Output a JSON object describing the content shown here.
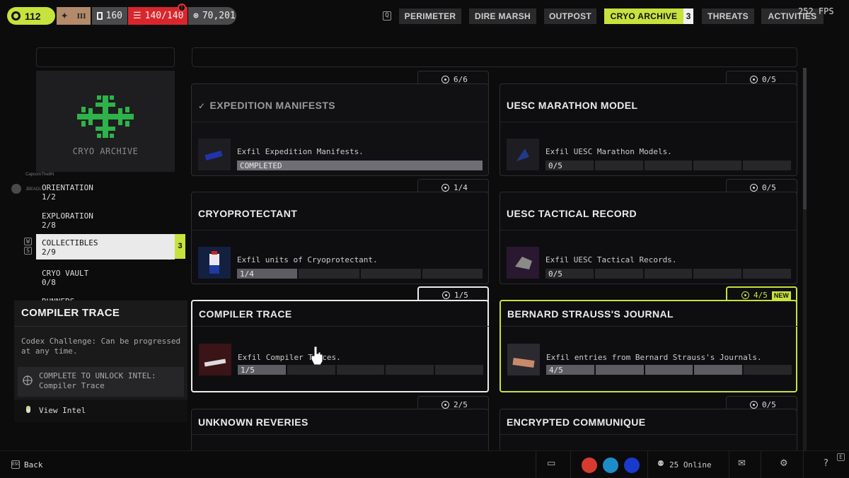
{
  "hud": {
    "level": "112",
    "rank_numeral": "III",
    "vault_count": "160",
    "health": "140/140",
    "credits": "70,201",
    "alert_icon": "!",
    "fps": "252 FPS"
  },
  "nav": {
    "q_key": "Q",
    "tabs": [
      {
        "label": "PERIMETER"
      },
      {
        "label": "DIRE MARSH"
      },
      {
        "label": "OUTPOST"
      },
      {
        "label": "CRYO ARCHIVE"
      },
      {
        "label": "THREATS"
      },
      {
        "label": "ACTIVITIES"
      }
    ],
    "active_count": "3",
    "e_key": "E"
  },
  "left": {
    "emblem_label": "CRYO ARCHIVE",
    "emblem_color": "#2fb24a",
    "categories": [
      {
        "name": "ORIENTATION",
        "progress": "1/2"
      },
      {
        "name": "EXPLORATION",
        "progress": "2/8"
      },
      {
        "name": "COLLECTIBLES",
        "progress": "2/9"
      },
      {
        "name": "CRYO VAULT",
        "progress": "0/8"
      },
      {
        "name": "RUNNERS",
        "progress": ""
      }
    ],
    "active_badge": "3",
    "key_w": "W",
    "key_s": "S",
    "chat": [
      "CapcomThe8N",
      "JBEADL"
    ]
  },
  "info": {
    "title": "COMPILER TRACE",
    "desc": "Codex Challenge: Can be progressed at any time.",
    "unlock_line1": "COMPLETE TO UNLOCK INTEL:",
    "unlock_line2": "Compiler Trace",
    "view_intel": "View Intel"
  },
  "cards": [
    {
      "title": "EXPEDITION MANIFESTS",
      "count": "6/6",
      "desc": "Exfil Expedition Manifests.",
      "progress": "COMPLETED",
      "segments": 1,
      "filled": 1,
      "state": "completed",
      "thumb_icon": "blue-case-icon"
    },
    {
      "title": "UESC MARATHON MODEL",
      "count": "0/5",
      "desc": "Exfil UESC Marathon Models.",
      "progress": "0/5",
      "segments": 5,
      "filled": 0,
      "state": "normal",
      "thumb_icon": "model-icon"
    },
    {
      "title": "CRYOPROTECTANT",
      "count": "1/4",
      "desc": "Exfil units of Cryoprotectant.",
      "progress": "1/4",
      "segments": 4,
      "filled": 1,
      "state": "normal",
      "thumb_icon": "canister-icon"
    },
    {
      "title": "UESC TACTICAL RECORD",
      "count": "0/5",
      "desc": "Exfil UESC Tactical Records.",
      "progress": "0/5",
      "segments": 5,
      "filled": 0,
      "state": "normal",
      "thumb_icon": "record-icon"
    },
    {
      "title": "COMPILER TRACE",
      "count": "1/5",
      "desc": "Exfil Compiler Traces.",
      "progress": "1/5",
      "segments": 5,
      "filled": 1,
      "state": "selected",
      "thumb_icon": "trace-icon"
    },
    {
      "title": "BERNARD STRAUSS'S JOURNAL",
      "count": "4/5",
      "desc": "Exfil entries from Bernard Strauss's Journals.",
      "progress": "4/5",
      "segments": 5,
      "filled": 4,
      "state": "highlight",
      "badge": "NEW",
      "thumb_icon": "journal-icon"
    },
    {
      "title": "UNKNOWN REVERIES",
      "count": "2/5",
      "state": "normal"
    },
    {
      "title": "ENCRYPTED COMMUNIQUE",
      "count": "0/5",
      "state": "normal"
    }
  ],
  "bottom": {
    "esc_key": "ESC",
    "back": "Back",
    "online": "25 Online"
  },
  "colors": {
    "accent": "#c6e23c",
    "danger": "#d9262d"
  }
}
